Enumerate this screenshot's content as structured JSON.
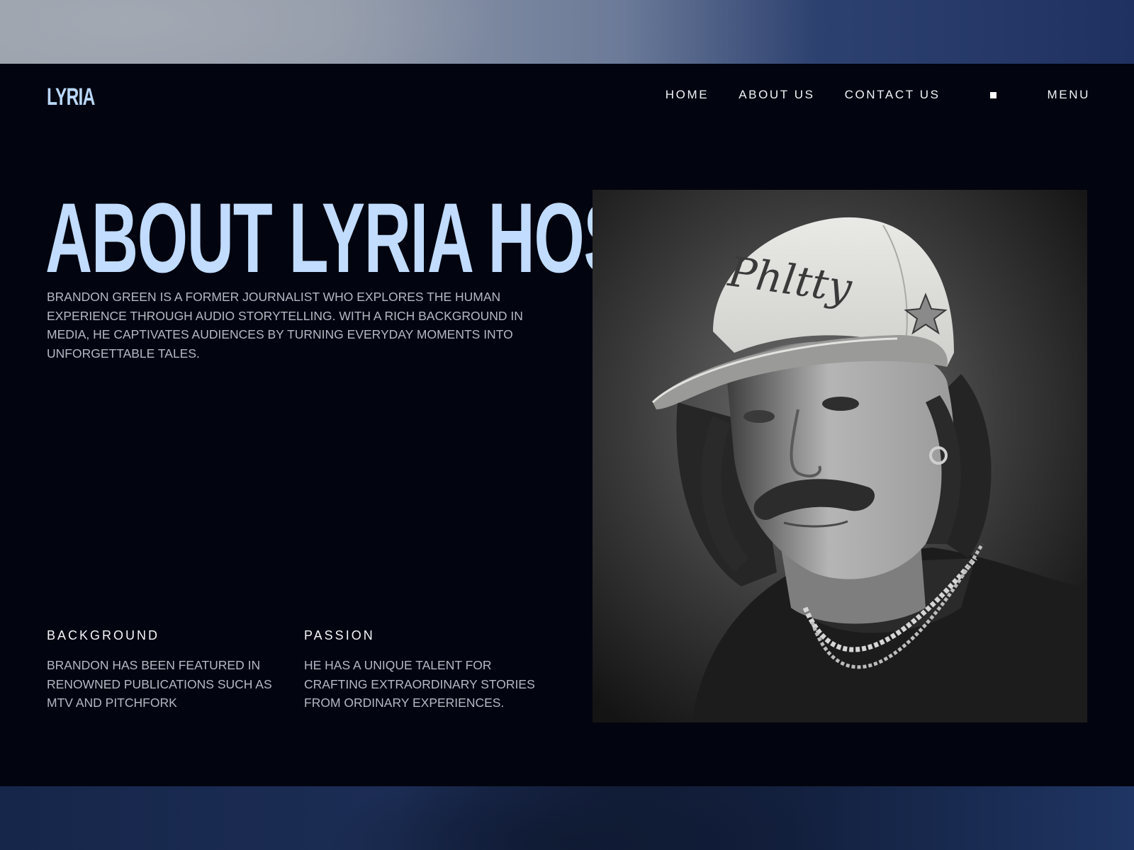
{
  "brand": {
    "logo": "LYRIA"
  },
  "nav": {
    "links": [
      "HOME",
      "ABOUT US",
      "CONTACT US"
    ],
    "menu_label": "MENU"
  },
  "hero": {
    "title": "ABOUT LYRIA HOST",
    "description": "BRANDON GREEN IS A FORMER JOURNALIST WHO EXPLORES THE HUMAN EXPERIENCE THROUGH AUDIO STORYTELLING. WITH A RICH BACKGROUND IN MEDIA, HE CAPTIVATES AUDIENCES BY TURNING EVERYDAY MOMENTS INTO UNFORGETTABLE TALES."
  },
  "features": [
    {
      "title": "BACKGROUND",
      "text": "BRANDON HAS BEEN FEATURED IN RENOWNED PUBLICATIONS SUCH AS MTV AND PITCHFORK"
    },
    {
      "title": "PASSION",
      "text": "HE HAS A UNIQUE TALENT FOR CRAFTING EXTRAORDINARY STORIES FROM ORDINARY EXPERIENCES."
    }
  ],
  "photo": {
    "cap_text": "Phltty"
  },
  "colors": {
    "accent": "#c1dcff",
    "page_bg": "#02040f",
    "body_text": "#b4b9c4"
  }
}
